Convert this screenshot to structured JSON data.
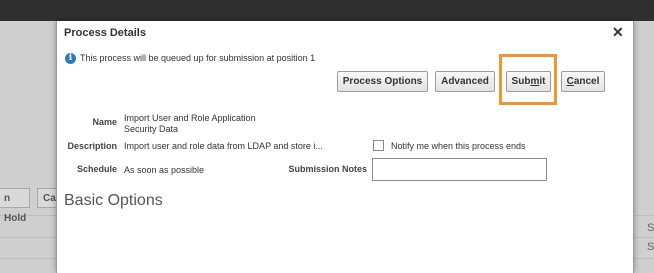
{
  "background": {
    "buttons": [
      "n Hold",
      "Ca"
    ],
    "right_letters": [
      "S",
      "S"
    ]
  },
  "dialog": {
    "title": "Process Details",
    "close_icon": "close-icon",
    "info_icon": "info-icon",
    "info_message": "This process will be queued up for submission at position 1",
    "buttons": {
      "process_options": "Process Options",
      "advanced": "Advanced",
      "submit": "Submit",
      "cancel": "Cancel"
    },
    "highlight_color": "#f0962c",
    "fields": {
      "name_label": "Name",
      "name_value_line1": "Import User and Role Application",
      "name_value_line2": "Security Data",
      "description_label": "Description",
      "description_value": "Import user and role data from LDAP and store i...",
      "notify_label": "Notify me when this process ends",
      "notify_checked": false,
      "schedule_label": "Schedule",
      "schedule_value": "As soon as possible",
      "submission_notes_label": "Submission Notes",
      "submission_notes_value": ""
    },
    "section_title": "Basic Options"
  }
}
